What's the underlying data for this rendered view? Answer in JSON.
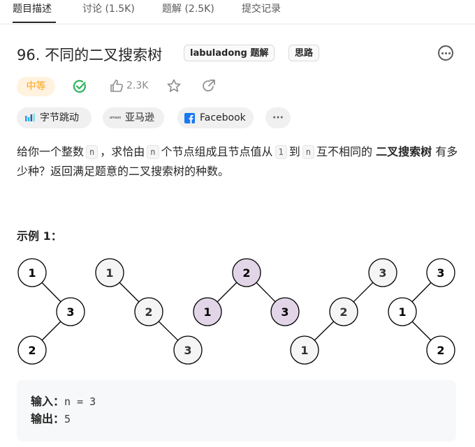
{
  "tabs": [
    {
      "label": "题目描述",
      "active": true
    },
    {
      "label": "讨论 (1.5K)",
      "active": false
    },
    {
      "label": "题解 (2.5K)",
      "active": false
    },
    {
      "label": "提交记录",
      "active": false
    }
  ],
  "problem": {
    "title": "96. 不同的二叉搜索树",
    "tags": [
      "labuladong 题解",
      "思路"
    ],
    "difficulty": "中等",
    "likes": "2.3K",
    "companies": [
      "字节跳动",
      "亚马逊",
      "Facebook"
    ],
    "more_label": "···",
    "description": {
      "p1": "给你一个整数",
      "c1": "n",
      "p2": "，求恰由",
      "c2": "n",
      "p3": "个节点组成且节点值从",
      "c3": "1",
      "p4": "到",
      "c4": "n",
      "p5": "互不相同的",
      "bold": "二叉搜索树",
      "p6": "有多少种？返回满足题意的二叉搜索树的种数。"
    }
  },
  "example": {
    "title": "示例 1：",
    "trees": [
      {
        "nodes": [
          {
            "v": "1"
          },
          {
            "v": "3"
          },
          {
            "v": "2"
          }
        ]
      },
      {
        "nodes": [
          {
            "v": "1"
          },
          {
            "v": "2"
          },
          {
            "v": "3"
          }
        ]
      },
      {
        "nodes": [
          {
            "v": "2"
          },
          {
            "v": "1"
          },
          {
            "v": "3"
          }
        ]
      },
      {
        "nodes": [
          {
            "v": "3"
          },
          {
            "v": "2"
          },
          {
            "v": "1"
          }
        ]
      },
      {
        "nodes": [
          {
            "v": "3"
          },
          {
            "v": "1"
          },
          {
            "v": "2"
          }
        ]
      }
    ],
    "input_label": "输入：",
    "input_value": "n = 3",
    "output_label": "输出：",
    "output_value": "5"
  },
  "colors": {
    "difficulty_medium": "#ffa116",
    "accepted": "#2db55d",
    "node_highlight": "#e1d5e7"
  },
  "icons": [
    "check-circle-icon",
    "thumbs-up-icon",
    "star-icon",
    "share-icon",
    "more-icon",
    "bytedance-icon",
    "amazon-icon",
    "facebook-icon"
  ]
}
